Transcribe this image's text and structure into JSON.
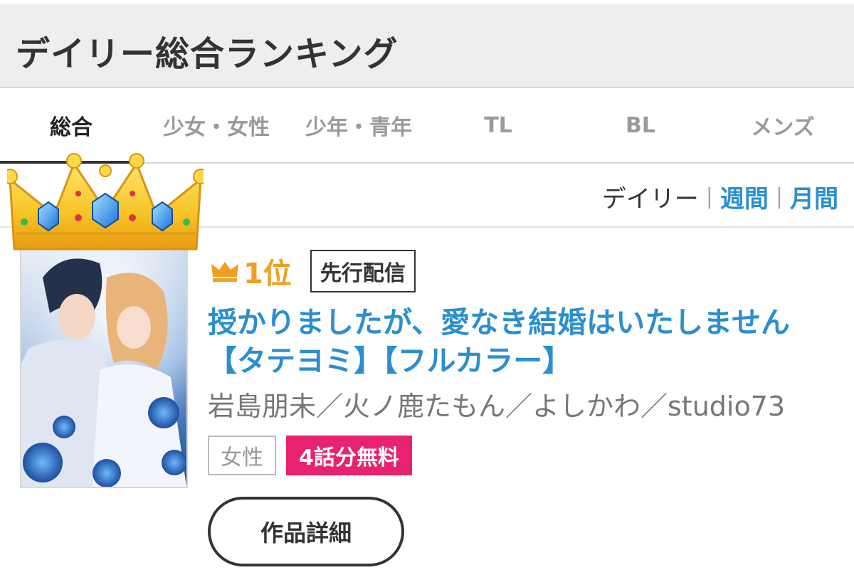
{
  "header": {
    "title": "デイリー総合ランキング"
  },
  "tabs": [
    {
      "label": "総合",
      "active": true
    },
    {
      "label": "少女・女性",
      "active": false
    },
    {
      "label": "少年・青年",
      "active": false
    },
    {
      "label": "TL",
      "active": false
    },
    {
      "label": "BL",
      "active": false
    },
    {
      "label": "メンズ",
      "active": false
    }
  ],
  "period": {
    "current": "デイリー",
    "separator": "|",
    "weekly": "週間",
    "monthly": "月間"
  },
  "item": {
    "rank": "1位",
    "advance_badge": "先行配信",
    "title": "授かりましたが、愛なき結婚はいたしません【タテヨミ】【フルカラー】",
    "authors": "岩島朋未／火ノ鹿たもん／よしかわ／studio73",
    "genre_tag": "女性",
    "free_tag": "4話分無料",
    "detail_button": "作品詳細",
    "cover_title": "授かりましたが、愛なき結婚はいたしません"
  },
  "colors": {
    "accent_blue": "#2b8fcf",
    "rank_gold": "#f0a020",
    "free_pink": "#e8226e",
    "header_bg": "#eeeeee"
  },
  "icons": {
    "rank": "crown-icon",
    "featured": "crown-icon"
  }
}
